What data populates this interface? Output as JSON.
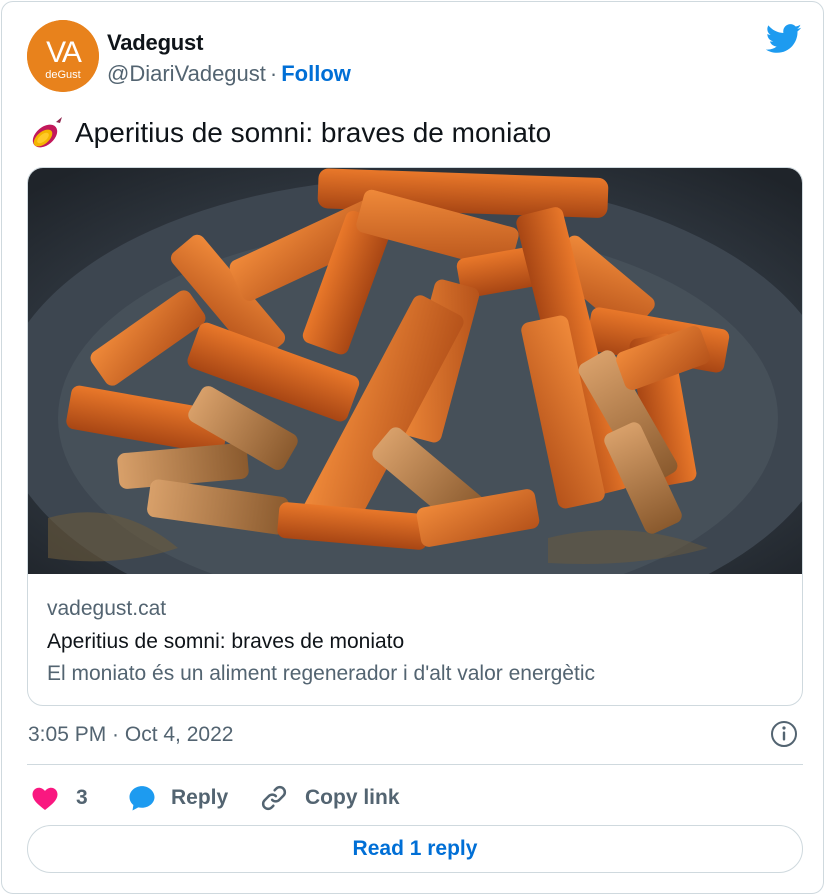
{
  "author": {
    "name": "Vadegust",
    "handle": "@DiariVadegust",
    "separator": "·",
    "follow_label": "Follow",
    "avatar_logo_text": "VA",
    "avatar_sub_text": "deGust"
  },
  "tweet": {
    "emoji_icon": "sweet-potato-icon",
    "text": "Aperitius de somni: braves de moniato"
  },
  "link_card": {
    "image_icon": "sweet-potato-fries-photo",
    "domain": "vadegust.cat",
    "title": "Aperitius de somni: braves de moniato",
    "description": "El moniato és un aliment regenerador i d'alt valor energètic"
  },
  "meta": {
    "timestamp": "3:05 PM · Oct 4, 2022"
  },
  "actions": {
    "like_count": "3",
    "reply_label": "Reply",
    "copy_link_label": "Copy link",
    "read_replies_label": "Read 1 reply"
  },
  "colors": {
    "brand_blue": "#1d9bf0",
    "link_blue": "#006fd6",
    "like_pink": "#f91880",
    "avatar_orange": "#e8821c",
    "secondary_text": "#536471",
    "border": "#cfd9de"
  }
}
